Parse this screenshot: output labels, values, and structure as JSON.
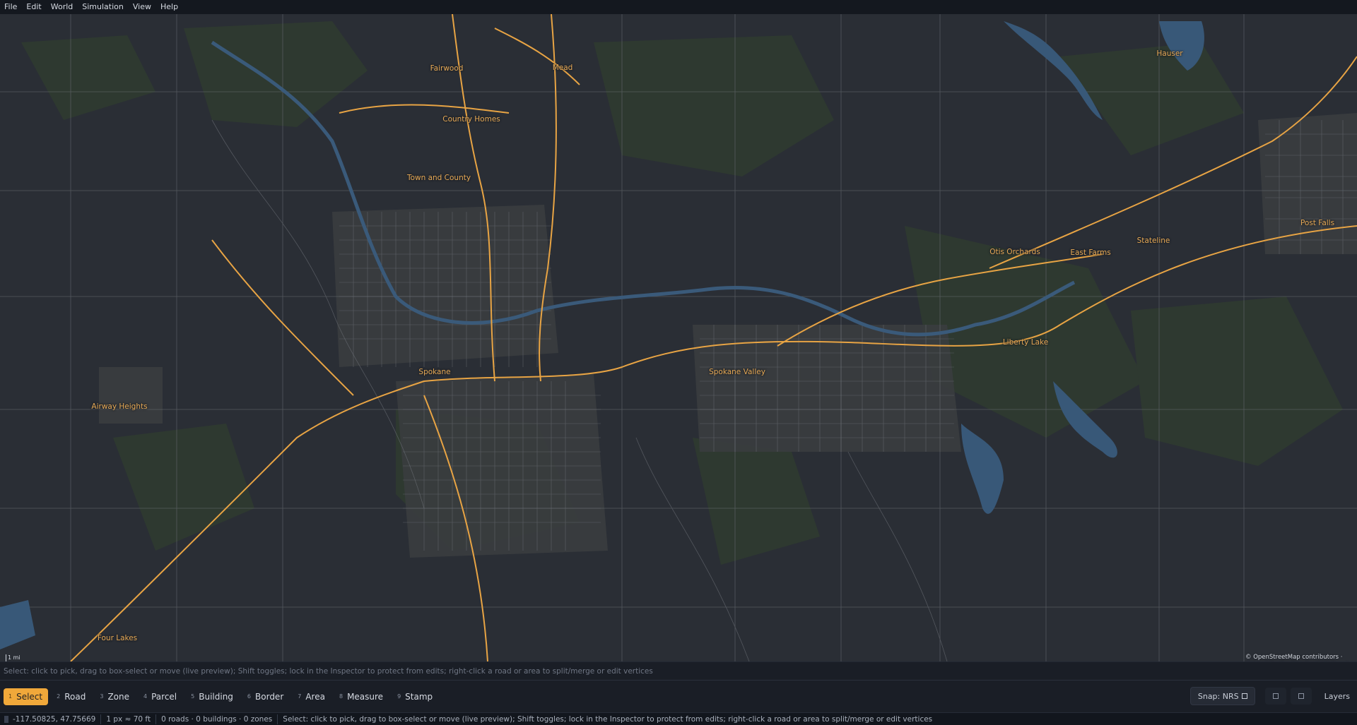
{
  "menu": [
    "File",
    "Edit",
    "World",
    "Simulation",
    "View",
    "Help"
  ],
  "map": {
    "places": [
      {
        "name": "Fairwood"
      },
      {
        "name": "Mead"
      },
      {
        "name": "Country Homes"
      },
      {
        "name": "Town and County"
      },
      {
        "name": "Hauser"
      },
      {
        "name": "Post Falls"
      },
      {
        "name": "Otis Orchards"
      },
      {
        "name": "East Farms"
      },
      {
        "name": "Stateline"
      },
      {
        "name": "Liberty Lake"
      },
      {
        "name": "Spokane"
      },
      {
        "name": "Spokane Valley"
      },
      {
        "name": "Airway Heights"
      },
      {
        "name": "Four Lakes"
      }
    ],
    "scale_label": "1 mi",
    "attribution": "© OpenStreetMap contributors · Natural Earth · Terrain: AWS Terrain Tiles",
    "colors": {
      "background": "#2a2e35",
      "forest": "#2f3d30",
      "water": "#3a5a7a",
      "highway": "#e8a444",
      "street": "#8c8f96"
    }
  },
  "hint": "Select: click to pick, drag to box-select or move (live preview); Shift toggles; lock in the Inspector to protect from edits; right-click a road or area to split/merge or edit vertices",
  "toolbar": {
    "tools": [
      {
        "key": "1",
        "label": "Select",
        "active": true
      },
      {
        "key": "2",
        "label": "Road"
      },
      {
        "key": "3",
        "label": "Zone"
      },
      {
        "key": "4",
        "label": "Parcel"
      },
      {
        "key": "5",
        "label": "Building"
      },
      {
        "key": "6",
        "label": "Border"
      },
      {
        "key": "7",
        "label": "Area"
      },
      {
        "key": "8",
        "label": "Measure"
      },
      {
        "key": "9",
        "label": "Stamp"
      }
    ],
    "snap_label": "Snap: NRS",
    "layers_label": "Layers"
  },
  "status": {
    "coords": "-117.50825, 47.75669",
    "scale": "1 px ≈ 70 ft",
    "counts": "0 roads · 0 buildings · 0 zones",
    "message": "Select: click to pick, drag to box-select or move (live preview); Shift toggles; lock in the Inspector to protect from edits; right-click a road or area to split/merge or edit vertices"
  }
}
